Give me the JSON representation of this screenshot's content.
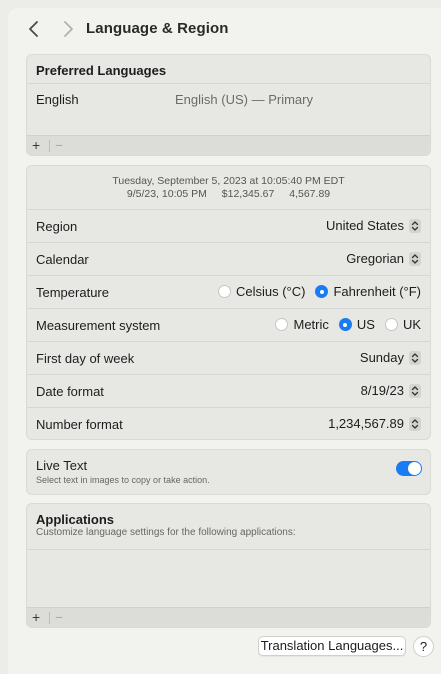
{
  "toolbar": {
    "title": "Language & Region",
    "back_icon": "chevron-left-icon",
    "forward_icon": "chevron-right-icon"
  },
  "preferred_languages": {
    "header": "Preferred Languages",
    "items": [
      {
        "name": "English",
        "description": "English (US) — Primary"
      }
    ],
    "add_label": "+",
    "remove_label": "−"
  },
  "preview": {
    "line1": "Tuesday, September 5, 2023 at 10:05:40 PM EDT",
    "date_short": "9/5/23, 10:05 PM",
    "currency": "$12,345.67",
    "number": "4,567.89"
  },
  "settings": {
    "region": {
      "label": "Region",
      "value": "United States"
    },
    "calendar": {
      "label": "Calendar",
      "value": "Gregorian"
    },
    "temperature": {
      "label": "Temperature",
      "options": [
        "Celsius (°C)",
        "Fahrenheit (°F)"
      ],
      "selected": "Fahrenheit (°F)"
    },
    "measurement": {
      "label": "Measurement system",
      "options": [
        "Metric",
        "US",
        "UK"
      ],
      "selected": "US"
    },
    "first_day": {
      "label": "First day of week",
      "value": "Sunday"
    },
    "date_format": {
      "label": "Date format",
      "value": "8/19/23"
    },
    "number_format": {
      "label": "Number format",
      "value": "1,234,567.89"
    }
  },
  "live_text": {
    "title": "Live Text",
    "subtitle": "Select text in images to copy or take action.",
    "enabled": true
  },
  "applications": {
    "title": "Applications",
    "subtitle": "Customize language settings for the following applications:",
    "add_label": "+",
    "remove_label": "−"
  },
  "footer": {
    "translation_button": "Translation Languages...",
    "help_label": "?"
  },
  "colors": {
    "accent": "#1a7cf2",
    "background": "#ecece8",
    "group": "#e7e8e3"
  }
}
